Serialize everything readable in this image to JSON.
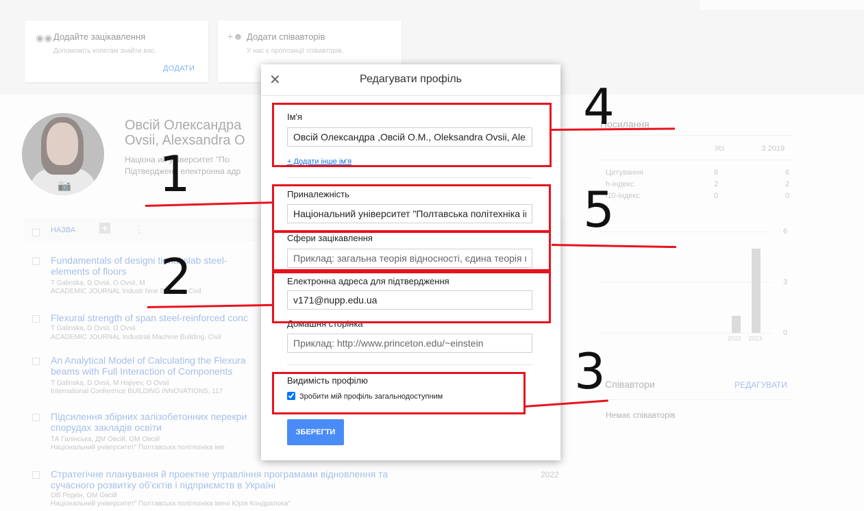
{
  "top_cards": {
    "interests": {
      "title": "Додайте зацікавлення",
      "subtitle": "Допоможіть колегам знайти вас.",
      "action": "ДОДАТИ"
    },
    "coauthors": {
      "title": "Додати співавторів",
      "subtitle": "У нас є пропозиції співавторів."
    }
  },
  "profile": {
    "name_line1": "Овсій Олександра",
    "name_line2": "Ovsii, Alexsandra O",
    "affiliation_line1": "Націона   ий університет \"По",
    "affiliation_line2": "Підтверджена електронна адр"
  },
  "list": {
    "header_label": "НАЗВА",
    "publications": [
      {
        "title_lines": [
          "Fundamentals of designi   tional slab steel-",
          "elements of floors"
        ],
        "authors": "T Galinska, D Ovsii, O Ovsii, M",
        "venue": "ACADEMIC JOURNAL Industr   hine Building, Civil"
      },
      {
        "title_lines": [
          "Flexural strength of span steel-reinforced conc"
        ],
        "authors": "T Galinska, D Ovsii, O Ovsii",
        "venue": "ACADEMIC JOURNAL Industrial Machine Building, Civil"
      },
      {
        "title_lines": [
          "An Analytical Model of Calculating the Flexura",
          "beams with Full Interaction of Components"
        ],
        "authors": "T Galinska, D Ovsii, M Hajiyev, O Ovsii",
        "venue": "International Conference BUILDING INNOVATIONS, 117"
      },
      {
        "title_lines": [
          "Підсилення збірних залізобетонних перекри",
          "спорудах закладів освіти"
        ],
        "authors": "ТА Галінська, ДМ Овсій, ОМ Овсій",
        "venue": "Національний університет\" Полтавська політехніка іме"
      },
      {
        "title_lines": [
          "Стратегічне планування й проектне управління програмами відновлення та",
          "сучасного розвитку об'єктів і підприємств в Україні"
        ],
        "authors": "ОВ Редкін, ОМ Овсій",
        "venue": "Національний університет\" Полтавська політехніка імені Юрія Кондратюка\"",
        "year": "2022"
      }
    ]
  },
  "citations": {
    "title": "Посилання",
    "columns": [
      "Усі",
      "З 2019"
    ],
    "rows": [
      {
        "label": "Цитування",
        "all": "6",
        "since": "6"
      },
      {
        "label": "h-індекс",
        "all": "2",
        "since": "2"
      },
      {
        "label": "i10-індекс",
        "all": "0",
        "since": "0"
      }
    ],
    "chart": {
      "type": "bar",
      "categories": [
        "2022",
        "2023"
      ],
      "values": [
        1,
        5
      ],
      "y_ticks": [
        "6",
        "3",
        "0"
      ],
      "ylim": [
        0,
        6
      ]
    }
  },
  "coauthors_panel": {
    "title": "Співавтори",
    "edit": "РЕДАГУВАТИ",
    "empty": "Немає співавторів"
  },
  "modal": {
    "title": "Редагувати профіль",
    "name_label": "Ім'я",
    "name_value": "Овсій Олександра ,Овсій О.М., Oleksandra Ovsii, Alexsandra Ovsii",
    "add_name_link": "+ Додати інше ім'я",
    "affiliation_label": "Приналежність",
    "affiliation_value": "Національний університет \"Полтавська політехніка імені Юрія Кондратюка\"",
    "interests_label": "Сфери зацікавлення",
    "interests_placeholder": "Приклад: загальна теорія відносності, єдина теорія поля",
    "email_label": "Електронна адреса для підтвердження",
    "email_value": "v171@nupp.edu.ua",
    "homepage_label": "Домашня сторінка",
    "homepage_placeholder": "Приклад: http://www.princeton.edu/~einstein",
    "visibility_label": "Видимість профілю",
    "visibility_checkbox_label": "Зробити мій профіль загальнодоступним",
    "visibility_checked": true,
    "save_label": "ЗБЕРЕГТИ"
  },
  "annotations": {
    "n1": "1",
    "n2": "2",
    "n3": "3",
    "n4": "4",
    "n5": "5"
  }
}
